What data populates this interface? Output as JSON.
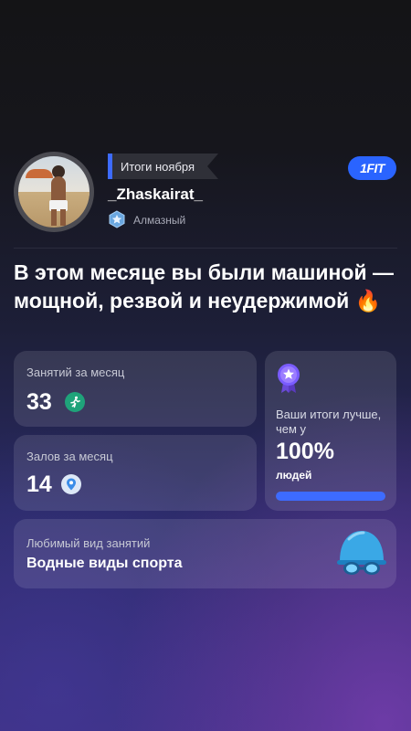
{
  "header": {
    "period_tag": "Итоги ноября",
    "username": "_Zhaskairat_",
    "rank_label": "Алмазный",
    "brand_logo": "1FIT"
  },
  "headline": "В этом месяце вы были машиной — мощной, резвой и неудержимой",
  "headline_emoji": "🔥",
  "stats": {
    "sessions_label": "Занятий за месяц",
    "sessions_value": "33",
    "sessions_icon": "running-person-icon",
    "gyms_label": "Залов за месяц",
    "gyms_value": "14",
    "gyms_icon": "location-pin-icon"
  },
  "comparison": {
    "icon": "medal-star-icon",
    "label": "Ваши итоги лучше, чем у",
    "value": "100%",
    "suffix": "людей",
    "progress": 1.0
  },
  "favorite": {
    "label": "Любимый вид занятий",
    "value": "Водные виды спорта",
    "icon": "swim-cap-goggles-icon"
  },
  "colors": {
    "accent": "#3d6bff",
    "brand": "#2a64ff",
    "sessions_icon_bg": "#1fa37a",
    "gyms_icon_bg": "#4aa3f0",
    "medal": "#7a5cff",
    "swim_cap": "#3aa8e6"
  }
}
